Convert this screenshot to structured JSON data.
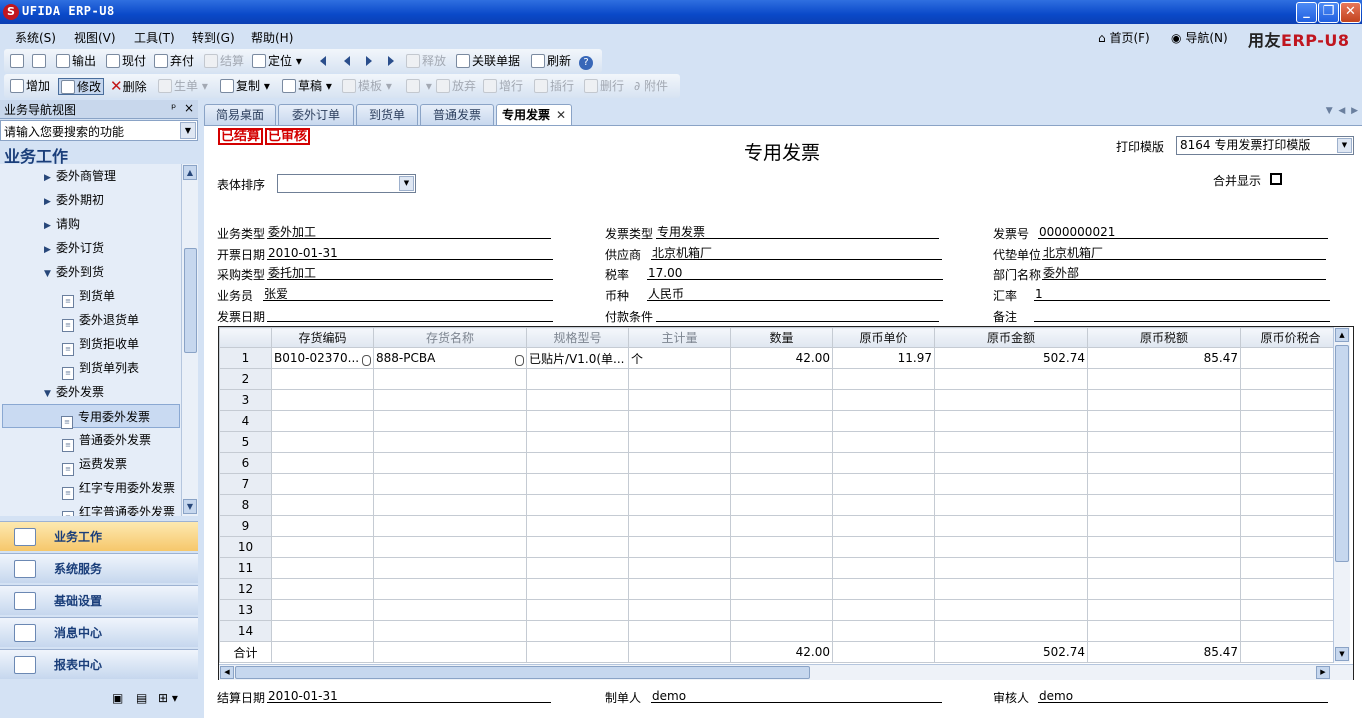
{
  "window": {
    "title": "UFIDA ERP-U8",
    "min_label": "_",
    "max_label": "❐",
    "close_label": "✕"
  },
  "menu": [
    "系统(S)",
    "视图(V)",
    "工具(T)",
    "转到(G)",
    "帮助(H)"
  ],
  "menu_right": {
    "home": "首页(F)",
    "nav": "导航(N)"
  },
  "logo": {
    "brand": "用友",
    "erp": "ERP-U8"
  },
  "toolbar1": {
    "output": "输出",
    "stock": "现付",
    "abandon": "弃付",
    "settle": "结算",
    "locate": "定位",
    "release": "释放",
    "related": "关联单据",
    "refresh": "刷新"
  },
  "toolbar2": {
    "add": "增加",
    "edit": "修改",
    "delete": "删除",
    "generate": "生单",
    "copy": "复制",
    "draft": "草稿",
    "template": "模板",
    "discard": "放弃",
    "add_row": "增行",
    "insert_row": "插行",
    "delete_row": "删行",
    "attach": "附件"
  },
  "nav": {
    "header": "业务导航视图",
    "pin": "ᵖ",
    "close": "×",
    "search_placeholder": "请输入您要搜索的功能",
    "title": "业务工作",
    "items": [
      {
        "label": "委外商管理"
      },
      {
        "label": "委外期初"
      },
      {
        "label": "请购"
      },
      {
        "label": "委外订货"
      },
      {
        "label": "委外到货"
      },
      {
        "label": "到货单"
      },
      {
        "label": "委外退货单"
      },
      {
        "label": "到货拒收单"
      },
      {
        "label": "到货单列表"
      },
      {
        "label": "委外发票"
      },
      {
        "label": "专用委外发票"
      },
      {
        "label": "普通委外发票"
      },
      {
        "label": "运费发票"
      },
      {
        "label": "红字专用委外发票"
      },
      {
        "label": "红字普通委外发票"
      }
    ],
    "sections": [
      {
        "label": "业务工作"
      },
      {
        "label": "系统服务"
      },
      {
        "label": "基础设置"
      },
      {
        "label": "消息中心"
      },
      {
        "label": "报表中心"
      }
    ]
  },
  "tabs": [
    {
      "label": "简易桌面"
    },
    {
      "label": "委外订单"
    },
    {
      "label": "到货单"
    },
    {
      "label": "普通发票"
    },
    {
      "label": "专用发票",
      "close": "✕"
    }
  ],
  "doc": {
    "stamp1": "已结算",
    "stamp2": "已审核",
    "title": "专用发票",
    "print_template_label": "打印模版",
    "print_template_value": "8164 专用发票打印模版",
    "sort_label": "表体排序",
    "merge_label": "合并显示",
    "fields": {
      "biz_type_l": "业务类型",
      "biz_type": "委外加工",
      "inv_type_l": "发票类型",
      "inv_type": "专用发票",
      "inv_no_l": "发票号",
      "inv_no": "0000000021",
      "date_l": "开票日期",
      "date": "2010-01-31",
      "supplier_l": "供应商",
      "supplier": "北京机箱厂",
      "payer_l": "代垫单位",
      "payer": "北京机箱厂",
      "purchase_type_l": "采购类型",
      "purchase_type": "委托加工",
      "tax_rate_l": "税率",
      "tax_rate": "17.00",
      "dept_l": "部门名称",
      "dept": "委外部",
      "clerk_l": "业务员",
      "clerk": "张爱",
      "currency_l": "币种",
      "currency": "人民币",
      "exrate_l": "汇率",
      "exrate": "1",
      "issue_date_l": "发票日期",
      "issue_date": "",
      "pay_terms_l": "付款条件",
      "pay_terms": "",
      "memo_l": "备注",
      "memo": ""
    },
    "grid": {
      "headers": [
        "",
        "存货编码",
        "存货名称",
        "规格型号",
        "主计量",
        "数量",
        "原币单价",
        "原币金额",
        "原币税额",
        "原币价税合"
      ],
      "row1": {
        "no": "1",
        "code": "B010-02370...",
        "name": "888-PCBA",
        "spec": "已贴片/V1.0(单...",
        "unit": "个",
        "qty": "42.00",
        "price": "11.97",
        "amount": "502.74",
        "tax": "85.47"
      },
      "row_numbers": [
        "2",
        "3",
        "4",
        "5",
        "6",
        "7",
        "8",
        "9",
        "10",
        "11",
        "12",
        "13",
        "14"
      ],
      "sum": {
        "label": "合计",
        "qty": "42.00",
        "amount": "502.74",
        "tax": "85.47"
      }
    },
    "footer": {
      "settle_date_l": "结算日期",
      "settle_date": "2010-01-31",
      "maker_l": "制单人",
      "maker": "demo",
      "auditor_l": "审核人",
      "auditor": "demo"
    }
  }
}
